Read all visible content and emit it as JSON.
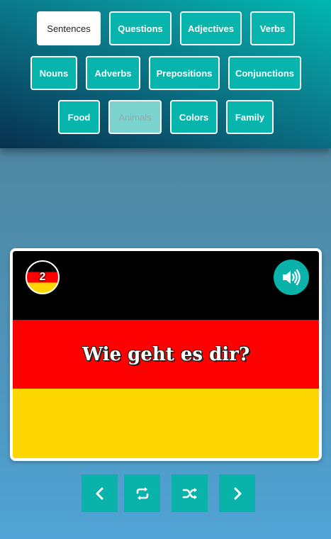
{
  "categories": {
    "sentences": "Sentences",
    "questions": "Questions",
    "adjectives": "Adjectives",
    "verbs": "Verbs",
    "nouns": "Nouns",
    "adverbs": "Adverbs",
    "prepositions": "Prepositions",
    "conjunctions": "Conjunctions",
    "food": "Food",
    "animals": "Animals",
    "colors": "Colors",
    "family": "Family",
    "active": "Sentences",
    "disabled": "Animals"
  },
  "card": {
    "language_flag": "germany-flag",
    "number": "2",
    "phrase": "Wie geht es dir?",
    "speaker_icon": "speaker-icon",
    "flag_colors": [
      "#000000",
      "#ff0000",
      "#ffd700"
    ]
  },
  "controls": {
    "icons": [
      "chevron-left-icon",
      "repeat-icon",
      "shuffle-icon",
      "chevron-right-icon"
    ]
  },
  "colors": {
    "accent": "#0ab3aa"
  }
}
